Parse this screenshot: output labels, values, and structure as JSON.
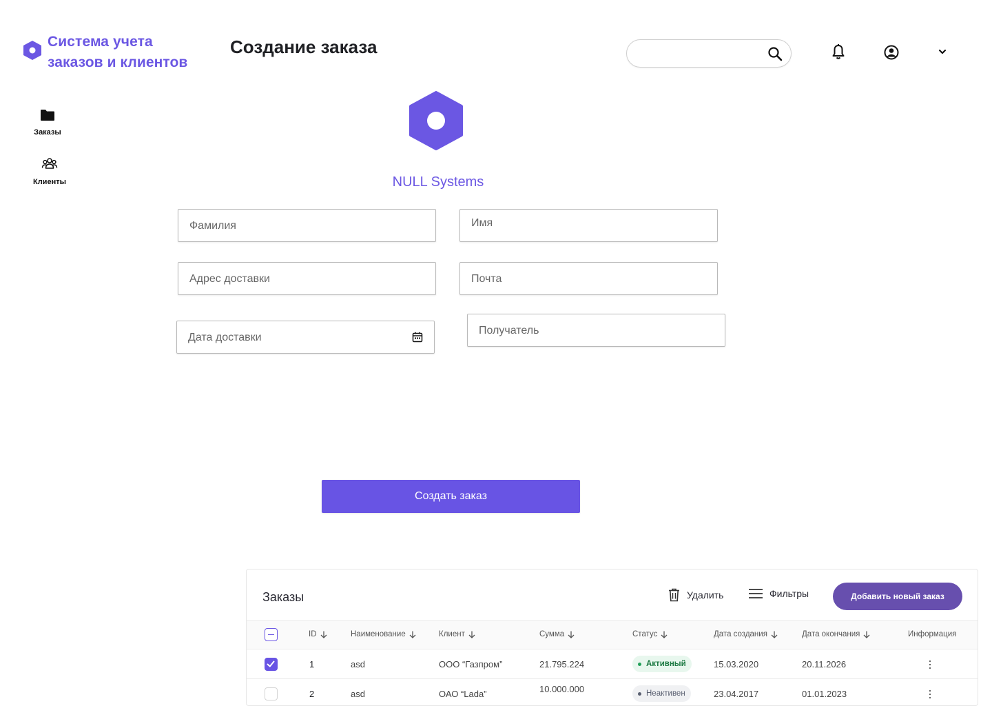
{
  "brand": {
    "name": "Система учета заказов и клиентов",
    "line1": "Система учета",
    "line2": "заказов и клиентов",
    "icon": "hexagon-logo-icon",
    "color": "#6b57e3"
  },
  "header": {
    "title": "Создание заказа",
    "search_placeholder": "",
    "icons": [
      "search-icon",
      "bell-icon",
      "user-circle-icon",
      "chevron-down-icon"
    ]
  },
  "sidebar": {
    "items": [
      {
        "label": "Заказы",
        "icon": "folder-icon"
      },
      {
        "label": "Клиенты",
        "icon": "users-icon"
      }
    ]
  },
  "company": {
    "name": "NULL Systems",
    "icon": "hexagon-logo-icon"
  },
  "form": {
    "last_name": {
      "placeholder": "Фамилия",
      "value": ""
    },
    "first_name": {
      "placeholder": "Имя",
      "value": ""
    },
    "address": {
      "placeholder": "Адрес доставки",
      "value": ""
    },
    "email": {
      "placeholder": "Почта",
      "value": ""
    },
    "delivery_date": {
      "placeholder": "Дата доставки",
      "value": "",
      "icon": "calendar-icon"
    },
    "recipient": {
      "placeholder": "Получатель",
      "value": ""
    },
    "submit_label": "Создать заказ",
    "accent": "#6854e4"
  },
  "orders": {
    "title": "Заказы",
    "delete_label": "Удалить",
    "filters_label": "Фильтры",
    "add_label": "Добавить новый заказ",
    "add_color": "#674fae",
    "columns": [
      "ID",
      "Наименование",
      "Клиент",
      "Сумма",
      "Статус",
      "Дата создания",
      "Дата  окончания",
      "Информация"
    ],
    "rows": [
      {
        "checked": true,
        "id": "1",
        "name": "asd",
        "client": "ООО “Газпром”",
        "sum": "21.795.224",
        "status": "Активный",
        "created": "15.03.2020",
        "ends": "20.11.2026"
      },
      {
        "checked": false,
        "id": "2",
        "name": "asd",
        "client": "ОАО “Lada”",
        "sum": "10.000.000",
        "status": "Неактивен",
        "created": "23.04.2017",
        "ends": "01.01.2023"
      }
    ],
    "status_colors": {
      "active": "#21a058",
      "inactive": "#5a6071"
    }
  }
}
